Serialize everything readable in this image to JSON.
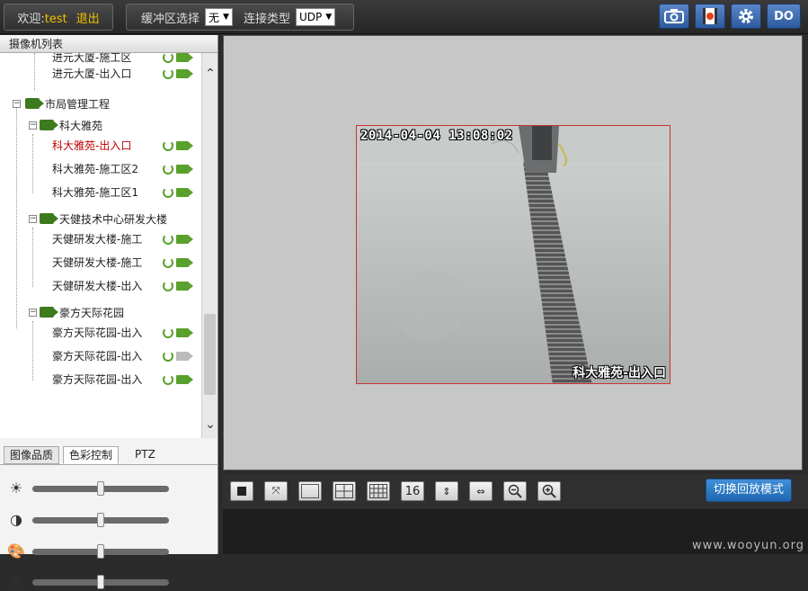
{
  "header": {
    "welcome_label": "欢迎:",
    "username": "test",
    "logout_label": "退出",
    "buffer_label": "缓冲区选择",
    "buffer_value": "无",
    "conn_label": "连接类型",
    "conn_value": "UDP",
    "do_label": "DO"
  },
  "camera_panel": {
    "title": "摄像机列表",
    "items": [
      {
        "label": "进元大厦-施工区",
        "status": "online"
      },
      {
        "label": "进元大厦-出入口",
        "status": "online"
      },
      {
        "label": "市局管理工程"
      },
      {
        "label": "科大雅苑"
      },
      {
        "label": "科大雅苑-出入口",
        "status": "online",
        "selected": true
      },
      {
        "label": "科大雅苑-施工区2",
        "status": "online"
      },
      {
        "label": "科大雅苑-施工区1",
        "status": "online"
      },
      {
        "label": "天健技术中心研发大楼"
      },
      {
        "label": "天健研发大楼-施工",
        "status": "online"
      },
      {
        "label": "天健研发大楼-施工",
        "status": "online"
      },
      {
        "label": "天健研发大楼-出入",
        "status": "online"
      },
      {
        "label": "豪方天际花园"
      },
      {
        "label": "豪方天际花园-出入",
        "status": "online"
      },
      {
        "label": "豪方天际花园-出入",
        "status": "offline"
      },
      {
        "label": "豪方天际花园-出入",
        "status": "online"
      }
    ]
  },
  "tabs": [
    "图像品质",
    "色彩控制",
    "PTZ"
  ],
  "active_tab": "色彩控制",
  "sliders": [
    {
      "name": "brightness",
      "icon": "sun-icon",
      "value": 0.5
    },
    {
      "name": "contrast",
      "icon": "contrast-icon",
      "value": 0.5
    },
    {
      "name": "saturation",
      "icon": "palette-icon",
      "value": 0.5
    },
    {
      "name": "hue",
      "icon": "hue-icon",
      "value": 0.5
    }
  ],
  "video": {
    "timestamp": "2014-04-04 13:08:02",
    "camera_name": "科大雅苑-出入口"
  },
  "controls": {
    "sixteen_label": "16",
    "playback_label": "切换回放模式"
  },
  "watermark": "www.wooyun.org",
  "colors": {
    "accent_blue": "#2f78c4",
    "online_green": "#5aa02c",
    "selected_red": "#c00000"
  }
}
